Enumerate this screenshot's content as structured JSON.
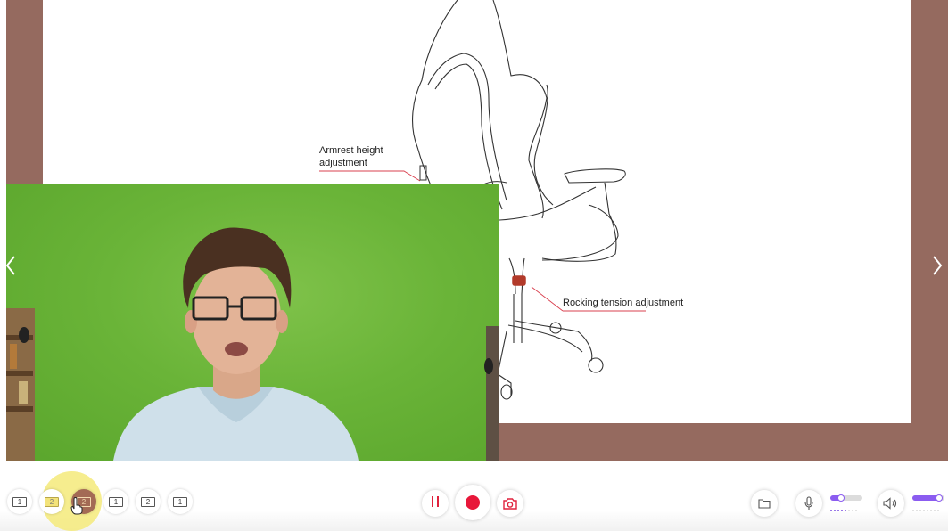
{
  "slide": {
    "callouts": {
      "armrest": [
        "Armrest height",
        "adjustment"
      ],
      "rocking": "Rocking tension adjustment"
    },
    "accent_red": "#d9404f"
  },
  "colors": {
    "stage_background": "#956a5f",
    "record_red": "#e8173a",
    "slider_purple": "#8b5cf0",
    "highlight_yellow": "#f4ea7a"
  },
  "navigation": {
    "prev_icon": "chevron-left-icon",
    "next_icon": "chevron-right-icon"
  },
  "toolbar": {
    "layouts": [
      {
        "label": "1",
        "icon": "layout-slide-only-icon"
      },
      {
        "label": "2",
        "icon": "layout-camera-only-icon"
      },
      {
        "label": "2",
        "icon": "layout-pip-icon",
        "selected": true
      },
      {
        "label": "1",
        "icon": "layout-pip-alt-icon"
      },
      {
        "label": "2",
        "icon": "layout-side-by-side-icon"
      },
      {
        "label": "1",
        "icon": "layout-split-icon"
      }
    ],
    "controls": {
      "pause_icon": "pause-icon",
      "record_icon": "record-icon",
      "snapshot_icon": "camera-icon",
      "folder_icon": "folder-icon",
      "mic_icon": "microphone-icon",
      "speaker_icon": "speaker-icon"
    },
    "mic_level": 0.4,
    "volume_level": 0.9,
    "mic_meter_active_bars": 5,
    "volume_meter_active_bars": 0,
    "meter_total_bars": 8
  }
}
